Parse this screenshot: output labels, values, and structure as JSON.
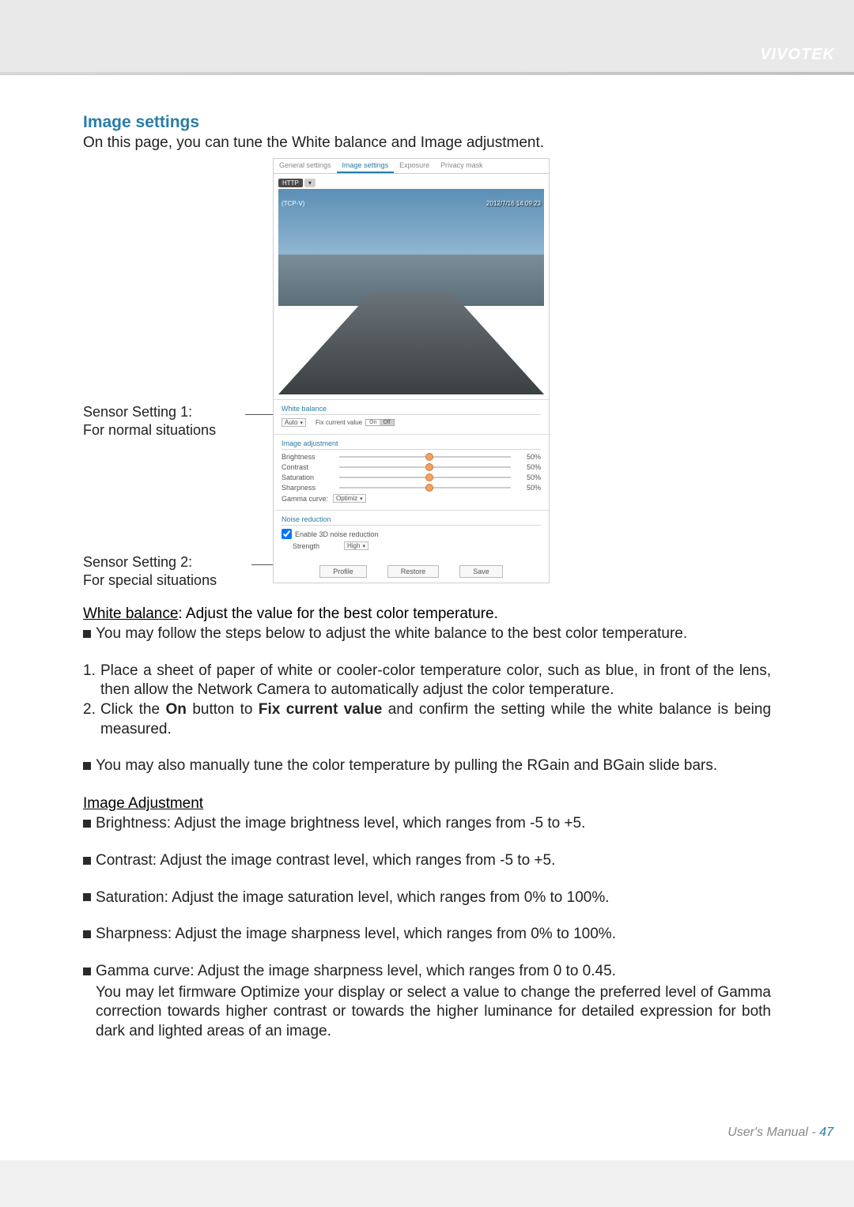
{
  "header": {
    "brand": "VIVOTEK"
  },
  "section": {
    "title": "Image settings",
    "intro": "On this page, you can tune the White balance and Image adjustment."
  },
  "annotations": {
    "s1": "Sensor Setting 1:\nFor normal situations",
    "s2": "Sensor Setting 2:\nFor special situations"
  },
  "screenshot": {
    "tabs": [
      "General settings",
      "Image settings",
      "Exposure",
      "Privacy mask"
    ],
    "active_tab": "Image settings",
    "live_button": "HTTP",
    "tcp": "(TCP-V)",
    "timestamp": "2012/7/16 14:09:23",
    "wb_group": "White balance",
    "wb_mode": "Auto",
    "fix_label": "Fix current value",
    "on": "On",
    "off": "Off",
    "ia_group": "Image adjustment",
    "sliders": [
      {
        "name": "Brightness",
        "value": "50%"
      },
      {
        "name": "Contrast",
        "value": "50%"
      },
      {
        "name": "Saturation",
        "value": "50%"
      },
      {
        "name": "Sharpness",
        "value": "50%"
      }
    ],
    "gamma_label": "Gamma curve:",
    "gamma_value": "Optimiz",
    "nr_group": "Noise reduction",
    "nr_checkbox": "Enable 3D noise reduction",
    "nr_strength_label": "Strength",
    "nr_strength_value": "High",
    "buttons": {
      "profile": "Profile",
      "restore": "Restore",
      "save": "Save"
    }
  },
  "body": {
    "wb_heading": "White balance",
    "wb_heading_tail": ": Adjust the value for the best color temperature.",
    "wb_bullet1": "You may follow the steps below to adjust the white balance to the best color temperature.",
    "step1": "Place a sheet of paper of white or cooler-color temperature color, such as blue, in front of the lens, then allow the Network Camera to automatically adjust the color temperature.",
    "step2_pre": "Click the ",
    "step2_on": "On",
    "step2_mid": " button to ",
    "step2_fix": "Fix current value",
    "step2_post": " and confirm the setting while the white balance is being measured.",
    "wb_bullet2": "You may also manually tune the color temperature by pulling the RGain and BGain slide bars.",
    "ia_heading": "Image Adjustment",
    "ia_brightness": "Brightness: Adjust the image brightness level, which ranges from -5 to +5.",
    "ia_contrast": "Contrast: Adjust the image contrast level, which ranges from -5 to +5.",
    "ia_saturation": "Saturation: Adjust the image saturation level, which ranges from 0% to 100%.",
    "ia_sharpness": "Sharpness: Adjust the image sharpness level, which ranges from 0% to 100%.",
    "ia_gamma_l1": "Gamma curve: Adjust the image sharpness level, which ranges from 0 to 0.45.",
    "ia_gamma_l2": "You may let firmware Optimize your display or select a value to change the preferred level of Gamma correction towards higher contrast or towards the higher luminance for detailed expression for both dark and lighted areas of an image."
  },
  "footer": {
    "manual": "User's Manual - ",
    "page": "47"
  }
}
